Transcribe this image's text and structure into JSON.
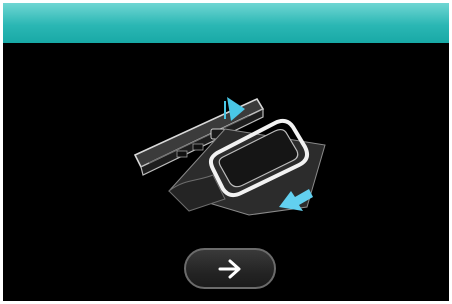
{
  "header": {
    "title": "",
    "color": "#2bb7b4"
  },
  "illustration": {
    "description_icon": "hoop-attach-illustration",
    "accent_color": "#49c7e6"
  },
  "navigation": {
    "next_button_icon": "arrow-right-icon"
  }
}
